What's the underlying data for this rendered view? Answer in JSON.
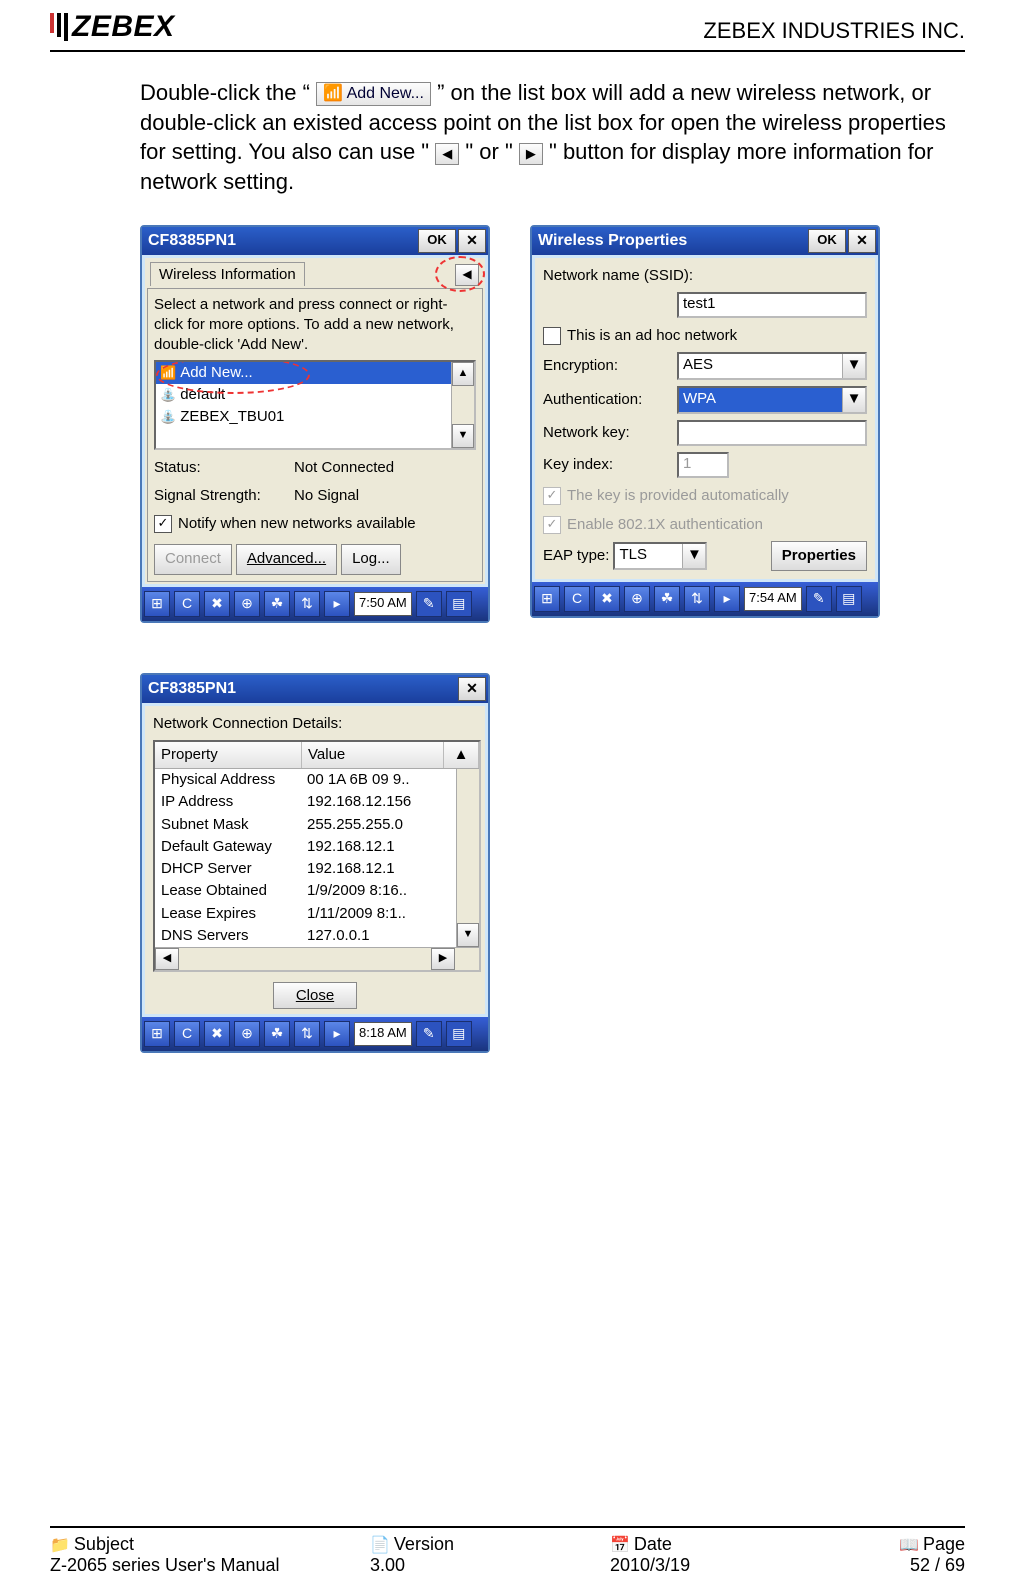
{
  "header": {
    "logo_text": "ZEBEX",
    "company": "ZEBEX INDUSTRIES INC."
  },
  "para": {
    "p1a": "Double-click the “ ",
    "add_new_btn": "📶 Add New...",
    "p1b": " ” on the list box will add a new wireless network, or double-click an existed access point on the list box for open the wireless properties for setting. You also can use \" ",
    "left_tri": "◀",
    "p1c": " \" or \" ",
    "right_tri": "▶",
    "p1d": " \" button for display more information for network setting."
  },
  "win1": {
    "title": "CF8385PN1",
    "ok": "OK",
    "close": "✕",
    "tab": "Wireless Information",
    "tab_arrow": "◀",
    "help": "Select a network and press connect or right-click for more options.  To add a new network, double-click 'Add New'.",
    "items": [
      {
        "icon": "📶",
        "label": "Add New...",
        "sel": true
      },
      {
        "icon": "⛲",
        "label": "default",
        "sel": false
      },
      {
        "icon": "⛲",
        "label": "ZEBEX_TBU01",
        "sel": false
      }
    ],
    "status_k": "Status:",
    "status_v": "Not Connected",
    "signal_k": "Signal Strength:",
    "signal_v": "No Signal",
    "notify": "Notify when new networks available",
    "btn_connect": "Connect",
    "btn_adv": "Advanced...",
    "btn_log": "Log...",
    "time": "7:50 AM"
  },
  "win2": {
    "title": "Wireless Properties",
    "ok": "OK",
    "close": "✕",
    "ssid_l": "Network name (SSID):",
    "ssid_v": "test1",
    "adhoc": "This is an ad hoc network",
    "enc_l": "Encryption:",
    "enc_v": "AES",
    "auth_l": "Authentication:",
    "auth_v": "WPA",
    "key_l": "Network key:",
    "key_v": "",
    "idx_l": "Key index:",
    "idx_v": "1",
    "auto": "The key is provided automatically",
    "dot1x": "Enable 802.1X authentication",
    "eap_l": "EAP type:",
    "eap_v": "TLS",
    "prop_btn": "Properties",
    "time": "7:54 AM"
  },
  "win3": {
    "title": "CF8385PN1",
    "close": "✕",
    "hdr": "Network Connection Details:",
    "col1": "Property",
    "col2": "Value",
    "rows": [
      {
        "k": "Physical Address",
        "v": "00 1A 6B 09 9.."
      },
      {
        "k": "IP Address",
        "v": "192.168.12.156"
      },
      {
        "k": "Subnet Mask",
        "v": "255.255.255.0"
      },
      {
        "k": "Default Gateway",
        "v": "192.168.12.1"
      },
      {
        "k": "DHCP Server",
        "v": "192.168.12.1"
      },
      {
        "k": "Lease Obtained",
        "v": "1/9/2009 8:16.."
      },
      {
        "k": "Lease Expires",
        "v": "1/11/2009 8:1.."
      },
      {
        "k": "DNS Servers",
        "v": "127.0.0.1"
      }
    ],
    "close_btn": "Close",
    "time": "8:18 AM"
  },
  "footer": {
    "subject_l": "Subject",
    "subject_v": "Z-2065 series User's Manual",
    "version_l": "Version",
    "version_v": "3.00",
    "date_l": "Date",
    "date_v": "2010/3/19",
    "page_l": "Page",
    "page_v": "52 / 69"
  }
}
